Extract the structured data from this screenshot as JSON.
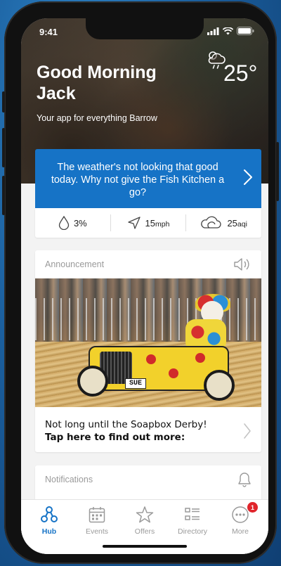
{
  "status_bar": {
    "time": "9:41"
  },
  "header": {
    "greeting": "Good Morning Jack",
    "subtitle": "Your app for everything Barrow",
    "temperature": "25°",
    "weather_icon": "partly-cloudy-rain-icon"
  },
  "weather_card": {
    "message": "The weather's not looking that good today. Why not give the Fish Kitchen a go?",
    "accent_color": "#1673C6"
  },
  "stats": [
    {
      "icon": "raindrop-icon",
      "value": "3%",
      "unit": ""
    },
    {
      "icon": "wind-direction-icon",
      "value": "15",
      "unit": "mph"
    },
    {
      "icon": "cloud-icon",
      "value": "25",
      "unit": "aqi"
    }
  ],
  "announcement": {
    "header": "Announcement",
    "image_plate": "SUE",
    "line1": "Not long until the Soapbox Derby!",
    "line2": "Tap here to find out more:"
  },
  "notifications": {
    "header": "Notifications"
  },
  "tabbar": {
    "tabs": [
      {
        "label": "Hub",
        "icon": "hub-icon",
        "active": true
      },
      {
        "label": "Events",
        "icon": "calendar-icon",
        "active": false
      },
      {
        "label": "Offers",
        "icon": "star-icon",
        "active": false
      },
      {
        "label": "Directory",
        "icon": "list-icon",
        "active": false
      },
      {
        "label": "More",
        "icon": "more-icon",
        "active": false,
        "badge": "1"
      }
    ]
  }
}
